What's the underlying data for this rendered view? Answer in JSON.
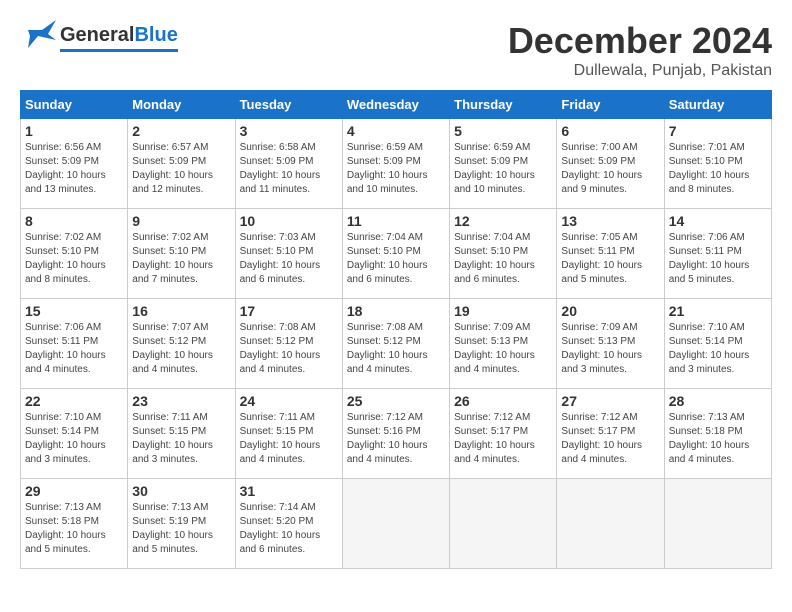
{
  "header": {
    "logo_general": "General",
    "logo_blue": "Blue",
    "month_title": "December 2024",
    "subtitle": "Dullewala, Punjab, Pakistan"
  },
  "calendar": {
    "days_of_week": [
      "Sunday",
      "Monday",
      "Tuesday",
      "Wednesday",
      "Thursday",
      "Friday",
      "Saturday"
    ],
    "weeks": [
      [
        {
          "day": "",
          "empty": true
        },
        {
          "day": "",
          "empty": true
        },
        {
          "day": "",
          "empty": true
        },
        {
          "day": "",
          "empty": true
        },
        {
          "day": "",
          "empty": true
        },
        {
          "day": "",
          "empty": true
        },
        {
          "day": "",
          "empty": true
        }
      ],
      [
        {
          "day": "1",
          "sunrise": "6:56 AM",
          "sunset": "5:09 PM",
          "daylight": "10 hours and 13 minutes."
        },
        {
          "day": "2",
          "sunrise": "6:57 AM",
          "sunset": "5:09 PM",
          "daylight": "10 hours and 12 minutes."
        },
        {
          "day": "3",
          "sunrise": "6:58 AM",
          "sunset": "5:09 PM",
          "daylight": "10 hours and 11 minutes."
        },
        {
          "day": "4",
          "sunrise": "6:59 AM",
          "sunset": "5:09 PM",
          "daylight": "10 hours and 10 minutes."
        },
        {
          "day": "5",
          "sunrise": "6:59 AM",
          "sunset": "5:09 PM",
          "daylight": "10 hours and 10 minutes."
        },
        {
          "day": "6",
          "sunrise": "7:00 AM",
          "sunset": "5:09 PM",
          "daylight": "10 hours and 9 minutes."
        },
        {
          "day": "7",
          "sunrise": "7:01 AM",
          "sunset": "5:10 PM",
          "daylight": "10 hours and 8 minutes."
        }
      ],
      [
        {
          "day": "8",
          "sunrise": "7:02 AM",
          "sunset": "5:10 PM",
          "daylight": "10 hours and 8 minutes."
        },
        {
          "day": "9",
          "sunrise": "7:02 AM",
          "sunset": "5:10 PM",
          "daylight": "10 hours and 7 minutes."
        },
        {
          "day": "10",
          "sunrise": "7:03 AM",
          "sunset": "5:10 PM",
          "daylight": "10 hours and 6 minutes."
        },
        {
          "day": "11",
          "sunrise": "7:04 AM",
          "sunset": "5:10 PM",
          "daylight": "10 hours and 6 minutes."
        },
        {
          "day": "12",
          "sunrise": "7:04 AM",
          "sunset": "5:10 PM",
          "daylight": "10 hours and 6 minutes."
        },
        {
          "day": "13",
          "sunrise": "7:05 AM",
          "sunset": "5:11 PM",
          "daylight": "10 hours and 5 minutes."
        },
        {
          "day": "14",
          "sunrise": "7:06 AM",
          "sunset": "5:11 PM",
          "daylight": "10 hours and 5 minutes."
        }
      ],
      [
        {
          "day": "15",
          "sunrise": "7:06 AM",
          "sunset": "5:11 PM",
          "daylight": "10 hours and 4 minutes."
        },
        {
          "day": "16",
          "sunrise": "7:07 AM",
          "sunset": "5:12 PM",
          "daylight": "10 hours and 4 minutes."
        },
        {
          "day": "17",
          "sunrise": "7:08 AM",
          "sunset": "5:12 PM",
          "daylight": "10 hours and 4 minutes."
        },
        {
          "day": "18",
          "sunrise": "7:08 AM",
          "sunset": "5:12 PM",
          "daylight": "10 hours and 4 minutes."
        },
        {
          "day": "19",
          "sunrise": "7:09 AM",
          "sunset": "5:13 PM",
          "daylight": "10 hours and 4 minutes."
        },
        {
          "day": "20",
          "sunrise": "7:09 AM",
          "sunset": "5:13 PM",
          "daylight": "10 hours and 3 minutes."
        },
        {
          "day": "21",
          "sunrise": "7:10 AM",
          "sunset": "5:14 PM",
          "daylight": "10 hours and 3 minutes."
        }
      ],
      [
        {
          "day": "22",
          "sunrise": "7:10 AM",
          "sunset": "5:14 PM",
          "daylight": "10 hours and 3 minutes."
        },
        {
          "day": "23",
          "sunrise": "7:11 AM",
          "sunset": "5:15 PM",
          "daylight": "10 hours and 3 minutes."
        },
        {
          "day": "24",
          "sunrise": "7:11 AM",
          "sunset": "5:15 PM",
          "daylight": "10 hours and 4 minutes."
        },
        {
          "day": "25",
          "sunrise": "7:12 AM",
          "sunset": "5:16 PM",
          "daylight": "10 hours and 4 minutes."
        },
        {
          "day": "26",
          "sunrise": "7:12 AM",
          "sunset": "5:17 PM",
          "daylight": "10 hours and 4 minutes."
        },
        {
          "day": "27",
          "sunrise": "7:12 AM",
          "sunset": "5:17 PM",
          "daylight": "10 hours and 4 minutes."
        },
        {
          "day": "28",
          "sunrise": "7:13 AM",
          "sunset": "5:18 PM",
          "daylight": "10 hours and 4 minutes."
        }
      ],
      [
        {
          "day": "29",
          "sunrise": "7:13 AM",
          "sunset": "5:18 PM",
          "daylight": "10 hours and 5 minutes."
        },
        {
          "day": "30",
          "sunrise": "7:13 AM",
          "sunset": "5:19 PM",
          "daylight": "10 hours and 5 minutes."
        },
        {
          "day": "31",
          "sunrise": "7:14 AM",
          "sunset": "5:20 PM",
          "daylight": "10 hours and 6 minutes."
        },
        {
          "day": "",
          "empty": true
        },
        {
          "day": "",
          "empty": true
        },
        {
          "day": "",
          "empty": true
        },
        {
          "day": "",
          "empty": true
        }
      ]
    ]
  }
}
